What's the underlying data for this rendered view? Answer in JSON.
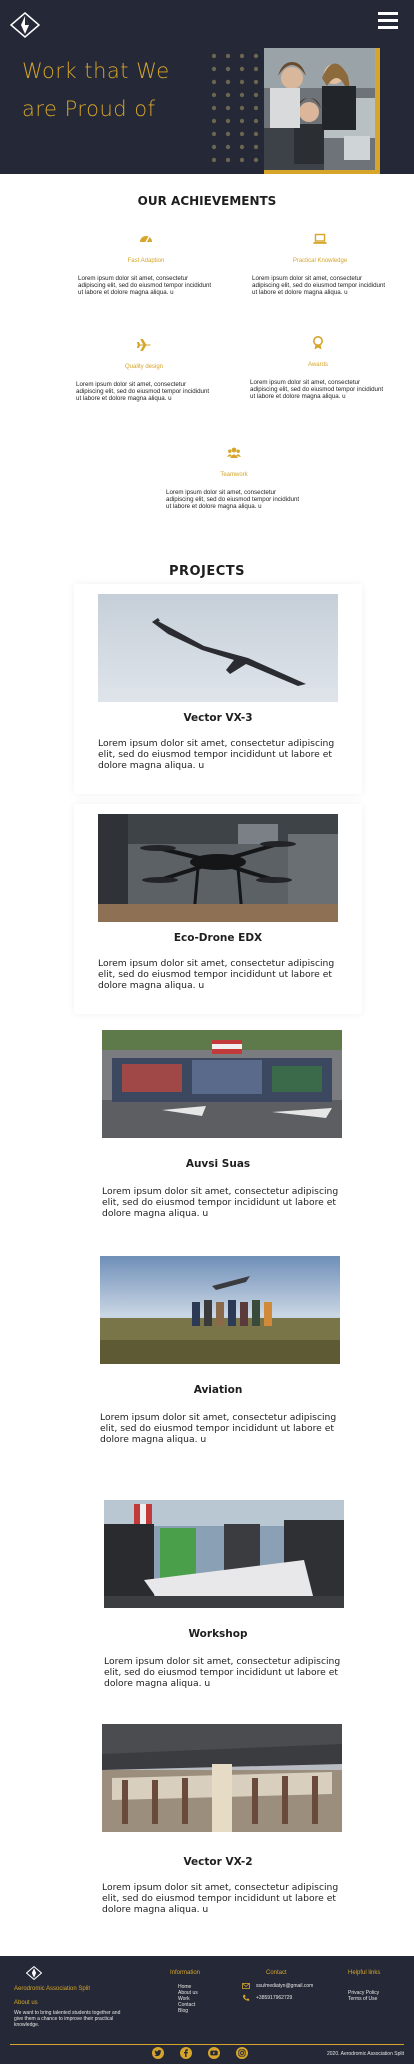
{
  "colors": {
    "accent": "#d6a52a",
    "dark": "#252836"
  },
  "hero": {
    "title_line1": "Work that We",
    "title_line2": "are Proud of",
    "logo_icon": "compass-logo-icon",
    "menu_icon": "hamburger-menu-icon"
  },
  "achievements": {
    "title": "OUR ACHIEVEMENTS",
    "items": [
      {
        "name": "Fast Adaption",
        "icon": "speedometer-icon",
        "text": "Lorem ipsum dolor sit amet, consectetur adipiscing elit, sed do eiusmod tempor incididunt ut labore et dolore magna aliqua. u"
      },
      {
        "name": "Practical Knowledge",
        "icon": "laptop-icon",
        "text": "Lorem ipsum dolor sit amet, consectetur adipiscing elit, sed do eiusmod tempor incididunt ut labore et dolore magna aliqua. u"
      },
      {
        "name": "Quality design",
        "icon": "airplane-icon",
        "text": "Lorem ipsum dolor sit amet, consectetur adipiscing elit, sed do eiusmod tempor incididunt ut labore et dolore magna aliqua. u"
      },
      {
        "name": "Awards",
        "icon": "award-ribbon-icon",
        "text": "Lorem ipsum dolor sit amet, consectetur adipiscing elit, sed do eiusmod tempor incididunt ut labore et dolore magna aliqua. u"
      },
      {
        "name": "Teamwork",
        "icon": "team-icon",
        "text": "Lorem ipsum dolor sit amet, consectetur adipiscing elit, sed do eiusmod tempor incididunt ut labore et dolore magna aliqua. u"
      }
    ]
  },
  "projects": {
    "title": "PROJECTS",
    "items": [
      {
        "name": "Vector VX-3",
        "text": "Lorem ipsum dolor sit amet, consectetur adipiscing elit, sed do eiusmod tempor incididunt ut labore et dolore magna aliqua. u"
      },
      {
        "name": "Eco-Drone EDX",
        "text": "Lorem ipsum dolor sit amet, consectetur adipiscing elit, sed do eiusmod tempor incididunt ut labore et dolore magna aliqua. u"
      },
      {
        "name": "Auvsi Suas",
        "text": "Lorem ipsum dolor sit amet, consectetur adipiscing elit, sed do eiusmod tempor incididunt ut labore et dolore magna aliqua. u"
      },
      {
        "name": "Aviation",
        "text": "Lorem ipsum dolor sit amet, consectetur adipiscing elit, sed do eiusmod tempor incididunt ut labore et dolore magna aliqua. u"
      },
      {
        "name": "Workshop",
        "text": "Lorem ipsum dolor sit amet, consectetur adipiscing elit, sed do eiusmod tempor incididunt ut labore et dolore magna aliqua. u"
      },
      {
        "name": "Vector VX-2",
        "text": "Lorem ipsum dolor sit amet, consectetur adipiscing elit, sed do eiusmod tempor incididunt ut labore et dolore magna aliqua. u"
      }
    ]
  },
  "footer": {
    "org_name": "Aerodromic Association Split",
    "about_heading": "About us",
    "about_text_1": "We want to bring talented students together and",
    "about_text_2": "give them a chance to improve their practical",
    "about_text_3": "knowledge.",
    "info_heading": "Information",
    "info_links": [
      "Home",
      "About us",
      "Work",
      "Contact",
      "Blog"
    ],
    "contact_heading": "Contact",
    "email": "ssu/mediatyn@gmail.com",
    "phone": "+385917962729",
    "helpful_heading": "Helpful links",
    "helpful_links": [
      "Privacy Policy",
      "Terms of Use"
    ],
    "social_icons": [
      "twitter-icon",
      "facebook-icon",
      "youtube-icon",
      "instagram-icon"
    ],
    "copyright": "2020. Aerodromic Association Split"
  }
}
